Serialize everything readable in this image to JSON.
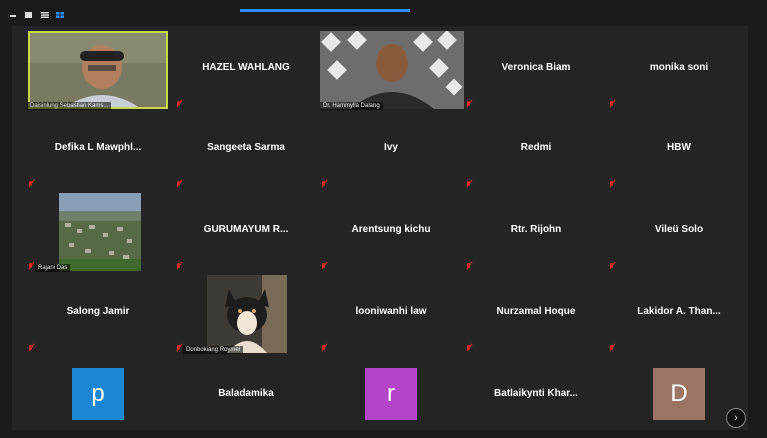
{
  "toolbar": {
    "icons": [
      "minimize-icon",
      "speaker-view-icon",
      "gallery-view-icon"
    ]
  },
  "participants": [
    {
      "name": "Daisinlung Sebastian Kams...",
      "video": true
    },
    {
      "name": "HAZEL WAHLANG",
      "video": false
    },
    {
      "name": "Dr. Hammylla Dalang",
      "video": true
    },
    {
      "name": "Veronica Biam",
      "video": false
    },
    {
      "name": "monika soni",
      "video": false
    },
    {
      "name": "Defika L Mawphl...",
      "video": false
    },
    {
      "name": "Sangeeta Sarma",
      "video": false
    },
    {
      "name": "Ivy",
      "video": false
    },
    {
      "name": "Redmi",
      "video": false
    },
    {
      "name": "HBW",
      "video": false
    },
    {
      "name": "Rajani Das",
      "video": true
    },
    {
      "name": "GURUMAYUM R...",
      "video": false
    },
    {
      "name": "Arentsung kichu",
      "video": false
    },
    {
      "name": "Rtr. Rijohn",
      "video": false
    },
    {
      "name": "Vileü Solo",
      "video": false
    },
    {
      "name": "Salong Jamir",
      "video": false
    },
    {
      "name": "Donbokiang Roymel",
      "video": true
    },
    {
      "name": "looniwanhi law",
      "video": false
    },
    {
      "name": "Nurzamal Hoque",
      "video": false
    },
    {
      "name": "Lakidor A. Than...",
      "video": false
    },
    {
      "name": "p",
      "avatar_letter": "p",
      "avatar_color": "#1b86d6"
    },
    {
      "name": "Baladamika",
      "video": false
    },
    {
      "name": "r",
      "avatar_letter": "r",
      "avatar_color": "#b245c8"
    },
    {
      "name": "Batlaikynti Khar...",
      "video": false
    },
    {
      "name": "D",
      "avatar_letter": "D",
      "avatar_color": "#9a7563"
    }
  ],
  "colors": {
    "active_speaker_border": "#c8d94a",
    "mic_muted": "#e02828",
    "accent": "#2d8cff"
  },
  "scroll_label": "›"
}
